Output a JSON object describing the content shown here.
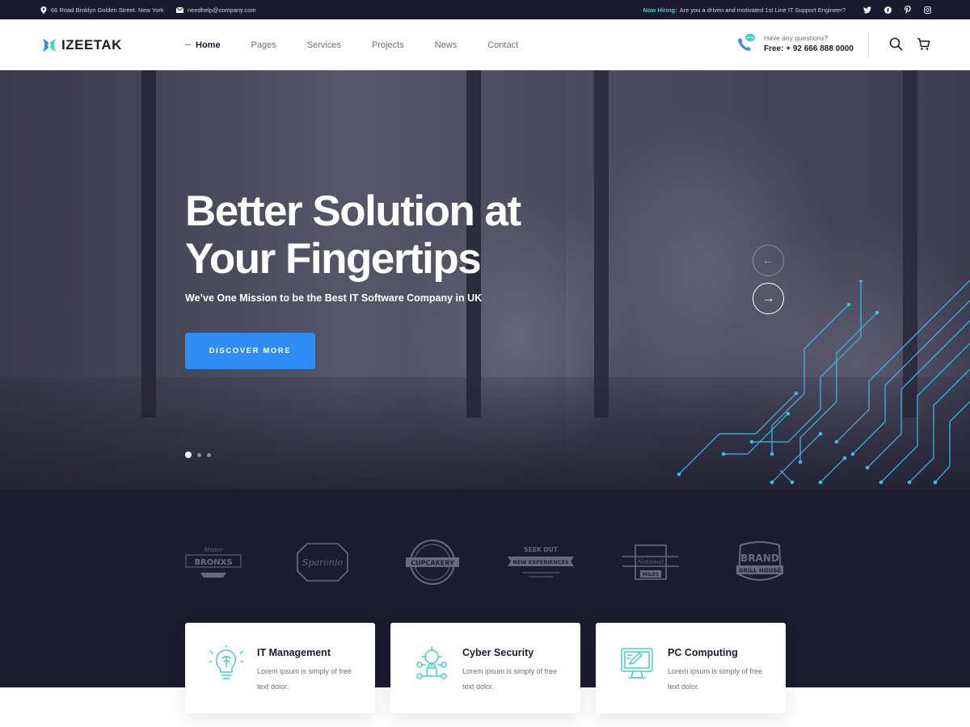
{
  "topbar": {
    "address": "66 Road Broklyn Golden Street. New York",
    "email": "needhelp@company.com",
    "hiring_label": "Now Hiring:",
    "hiring_text": "Are you a driven and motivated 1st Line IT Support Engineer?",
    "social": [
      "twitter-icon",
      "facebook-icon",
      "pinterest-icon",
      "instagram-icon"
    ]
  },
  "header": {
    "logo_text": "IZEETAK",
    "nav": [
      "Home",
      "Pages",
      "Services",
      "Projects",
      "News",
      "Contact"
    ],
    "active_nav": "Home",
    "question": "Have any questions?",
    "phone": "Free: + 92 666 888 0000"
  },
  "hero": {
    "title": "Better Solution at Your Fingertips",
    "subtitle": "We’ve One Mission to be the Best IT Software Company in UK",
    "cta": "DISCOVER MORE",
    "prev_arrow": "←",
    "next_arrow": "→",
    "slides": 3,
    "active_slide": 1
  },
  "brands": [
    {
      "top": "Mister",
      "main": "BRONXS"
    },
    {
      "top": "",
      "main": "Sparonio"
    },
    {
      "top": "",
      "main": "CUPCAKERY"
    },
    {
      "top": "SEEK OUT",
      "main": "NEW EXPERIENCES"
    },
    {
      "top": "National",
      "main": "MILES"
    },
    {
      "top": "BRAND",
      "main": "GRILL HOUSE"
    }
  ],
  "services": [
    {
      "title": "IT Management",
      "text": "Lorem ipsum is simply of free text dolor."
    },
    {
      "title": "Cyber Security",
      "text": "Lorem ipsum is simply of free text dolor."
    },
    {
      "title": "PC Computing",
      "text": "Lorem ipsum is simply of free text dolor."
    }
  ],
  "colors": {
    "accent": "#2e8df5",
    "teal": "#3ed3c4",
    "dark": "#1d1b2e",
    "topbar": "#1c1a2e"
  }
}
